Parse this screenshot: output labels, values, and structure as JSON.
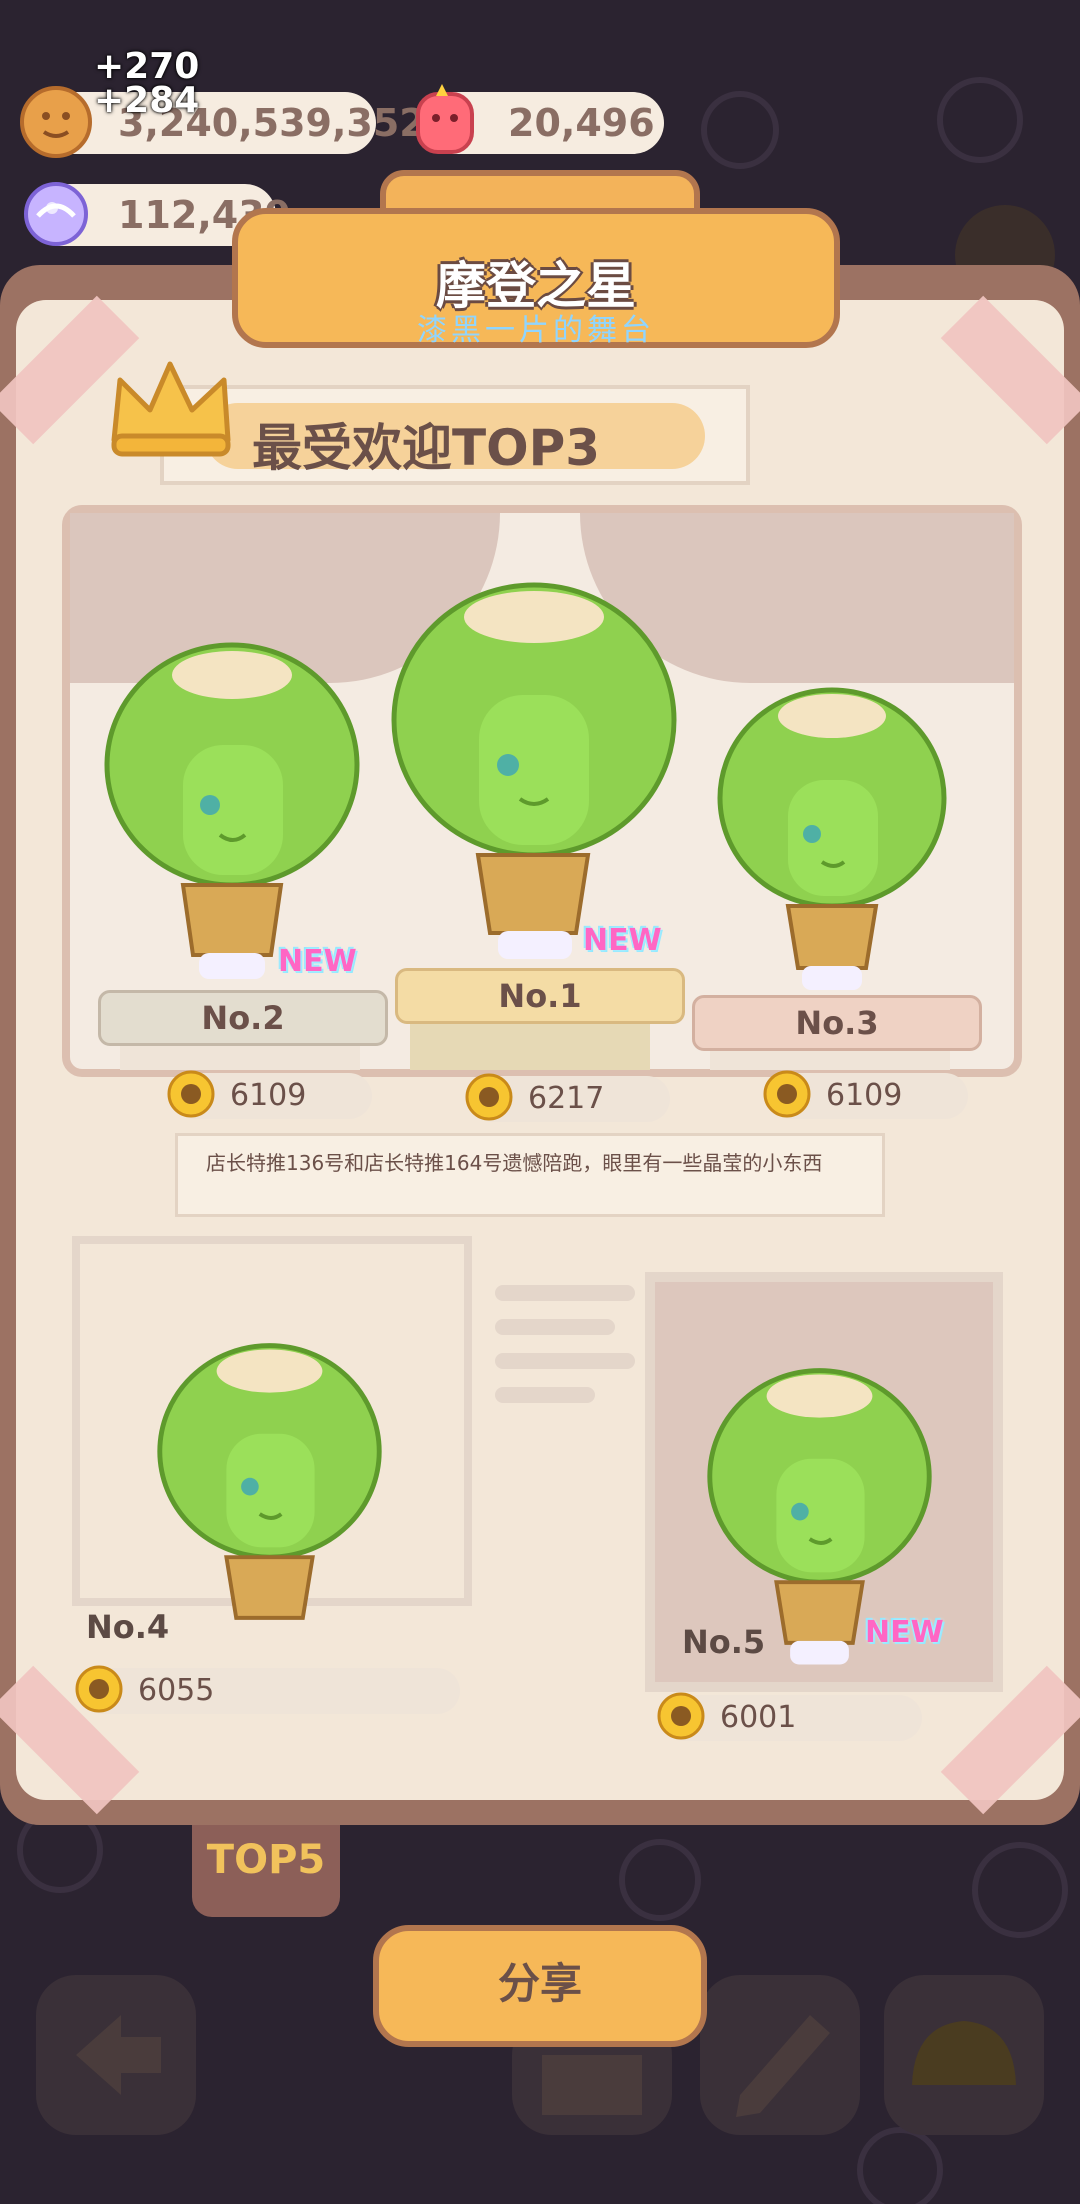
{
  "currencies": {
    "coins": {
      "value": "3,240,539,352",
      "gains": [
        "+270",
        "+284"
      ],
      "icon": "cookie-coin-icon"
    },
    "jelly": {
      "value": "20,496",
      "icon": "jelly-bear-icon"
    },
    "crystal": {
      "value": "112,439",
      "icon": "crystal-candy-icon"
    }
  },
  "title": {
    "main": "摩登之星",
    "subtitle": "漆黑一片的舞台"
  },
  "section": {
    "heading": "最受欢迎TOP3"
  },
  "podium": [
    {
      "rank": "No.2",
      "score": "6109",
      "new_badge": "NEW"
    },
    {
      "rank": "No.1",
      "score": "6217",
      "new_badge": "NEW"
    },
    {
      "rank": "No.3",
      "score": "6109",
      "new_badge": ""
    }
  ],
  "comment": "店长特推136号和店长特推164号遗憾陪跑，眼里有一些晶莹的小东西",
  "others": [
    {
      "rank": "No.4",
      "score": "6055",
      "new_badge": ""
    },
    {
      "rank": "No.5",
      "score": "6001",
      "new_badge": "NEW"
    }
  ],
  "tab_label": "TOP5",
  "share_button": "分享",
  "colors": {
    "background": "#2b2330",
    "board": "#9c7263",
    "paper": "#f3e7d8",
    "accent": "#f6b858",
    "new_badge": "#ff66c4",
    "character": "#8fd14f"
  },
  "bottom_nav": [
    "back-arrow-icon",
    "box-icon",
    "pencil-icon",
    "hard-hat-icon"
  ]
}
